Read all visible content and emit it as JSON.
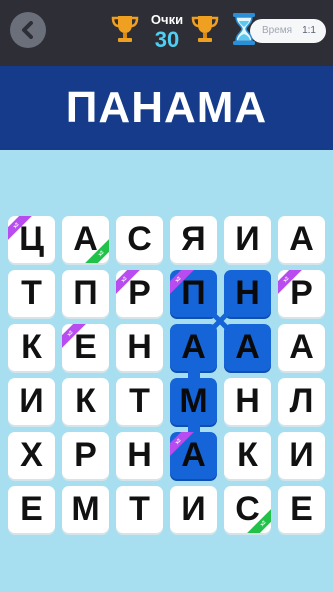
{
  "header": {
    "score_label": "Очки",
    "score_value": "30",
    "timer_label": "Время",
    "timer_value": "1:1"
  },
  "colors": {
    "topbar": "#2e2e37",
    "title_band": "#153b8a",
    "background": "#a8dff0",
    "selected_cell": "#1565d8",
    "trophy": "#f0a020",
    "ribbon_purple": "#b84cf0",
    "ribbon_green": "#22c24a"
  },
  "target_word": "ПАНАМА",
  "grid": {
    "rows": [
      [
        "Ц",
        "А",
        "С",
        "Я",
        "И",
        "А"
      ],
      [
        "Т",
        "П",
        "Р",
        "П",
        "Н",
        "Р"
      ],
      [
        "К",
        "Е",
        "Н",
        "А",
        "А",
        "А"
      ],
      [
        "И",
        "К",
        "Т",
        "М",
        "Н",
        "Л"
      ],
      [
        "Х",
        "Р",
        "Н",
        "А",
        "К",
        "И"
      ],
      [
        "Е",
        "М",
        "Т",
        "И",
        "С",
        "Е"
      ]
    ],
    "selected_cells": [
      [
        1,
        3
      ],
      [
        1,
        4
      ],
      [
        2,
        3
      ],
      [
        2,
        4
      ],
      [
        3,
        3
      ],
      [
        4,
        3
      ]
    ],
    "ribbons": [
      {
        "row": 0,
        "col": 0,
        "corner": "tl",
        "color": "purple",
        "text": "x2"
      },
      {
        "row": 0,
        "col": 1,
        "corner": "br",
        "color": "green",
        "text": "x2"
      },
      {
        "row": 1,
        "col": 2,
        "corner": "tl",
        "color": "purple",
        "text": "x2"
      },
      {
        "row": 1,
        "col": 3,
        "corner": "tl",
        "color": "purple",
        "text": "x2"
      },
      {
        "row": 1,
        "col": 5,
        "corner": "tl",
        "color": "purple",
        "text": "x2"
      },
      {
        "row": 2,
        "col": 1,
        "corner": "tl",
        "color": "purple",
        "text": "x2"
      },
      {
        "row": 4,
        "col": 3,
        "corner": "tl",
        "color": "purple",
        "text": "x2"
      },
      {
        "row": 5,
        "col": 4,
        "corner": "br",
        "color": "green",
        "text": "x2"
      }
    ]
  }
}
